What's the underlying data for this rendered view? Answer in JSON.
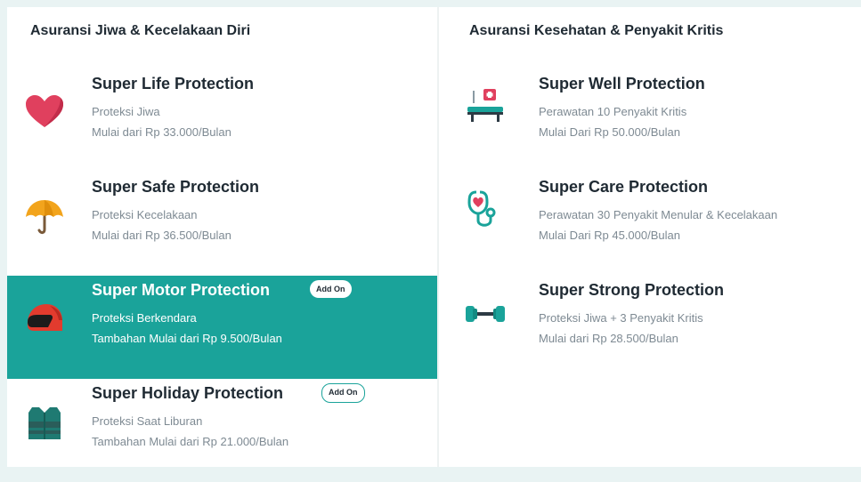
{
  "left": {
    "title": "Asuransi Jiwa & Kecelakaan Diri",
    "items": [
      {
        "name": "Super Life Protection",
        "sub": "Proteksi Jiwa",
        "price": "Mulai dari Rp 33.000/Bulan",
        "icon": "heart-icon"
      },
      {
        "name": "Super Safe Protection",
        "sub": "Proteksi Kecelakaan",
        "price": "Mulai dari Rp 36.500/Bulan",
        "icon": "umbrella-icon"
      },
      {
        "name": "Super Motor Protection",
        "badge": "Add On",
        "sub": "Proteksi Berkendara",
        "price": "Tambahan Mulai dari Rp 9.500/Bulan",
        "icon": "helmet-icon",
        "selected": true
      },
      {
        "name": "Super Holiday Protection",
        "badge": "Add On",
        "sub": "Proteksi Saat Liburan",
        "price": "Tambahan Mulai dari Rp 21.000/Bulan",
        "icon": "life-vest-icon"
      }
    ]
  },
  "right": {
    "title": "Asuransi Kesehatan & Penyakit Kritis",
    "items": [
      {
        "name": "Super Well Protection",
        "sub": "Perawatan 10 Penyakit Kritis",
        "price": "Mulai Dari Rp 50.000/Bulan",
        "icon": "hospital-bed-icon"
      },
      {
        "name": "Super Care Protection",
        "sub": "Perawatan 30 Penyakit Menular & Kecelakaan",
        "price": "Mulai Dari Rp 45.000/Bulan",
        "icon": "stethoscope-icon"
      },
      {
        "name": "Super Strong Protection",
        "sub": "Proteksi Jiwa + 3 Penyakit Kritis",
        "price": "Mulai dari Rp 28.500/Bulan",
        "icon": "dumbbell-icon"
      }
    ]
  },
  "colors": {
    "accent": "#1aa39a",
    "background": "#e9f3f3"
  }
}
